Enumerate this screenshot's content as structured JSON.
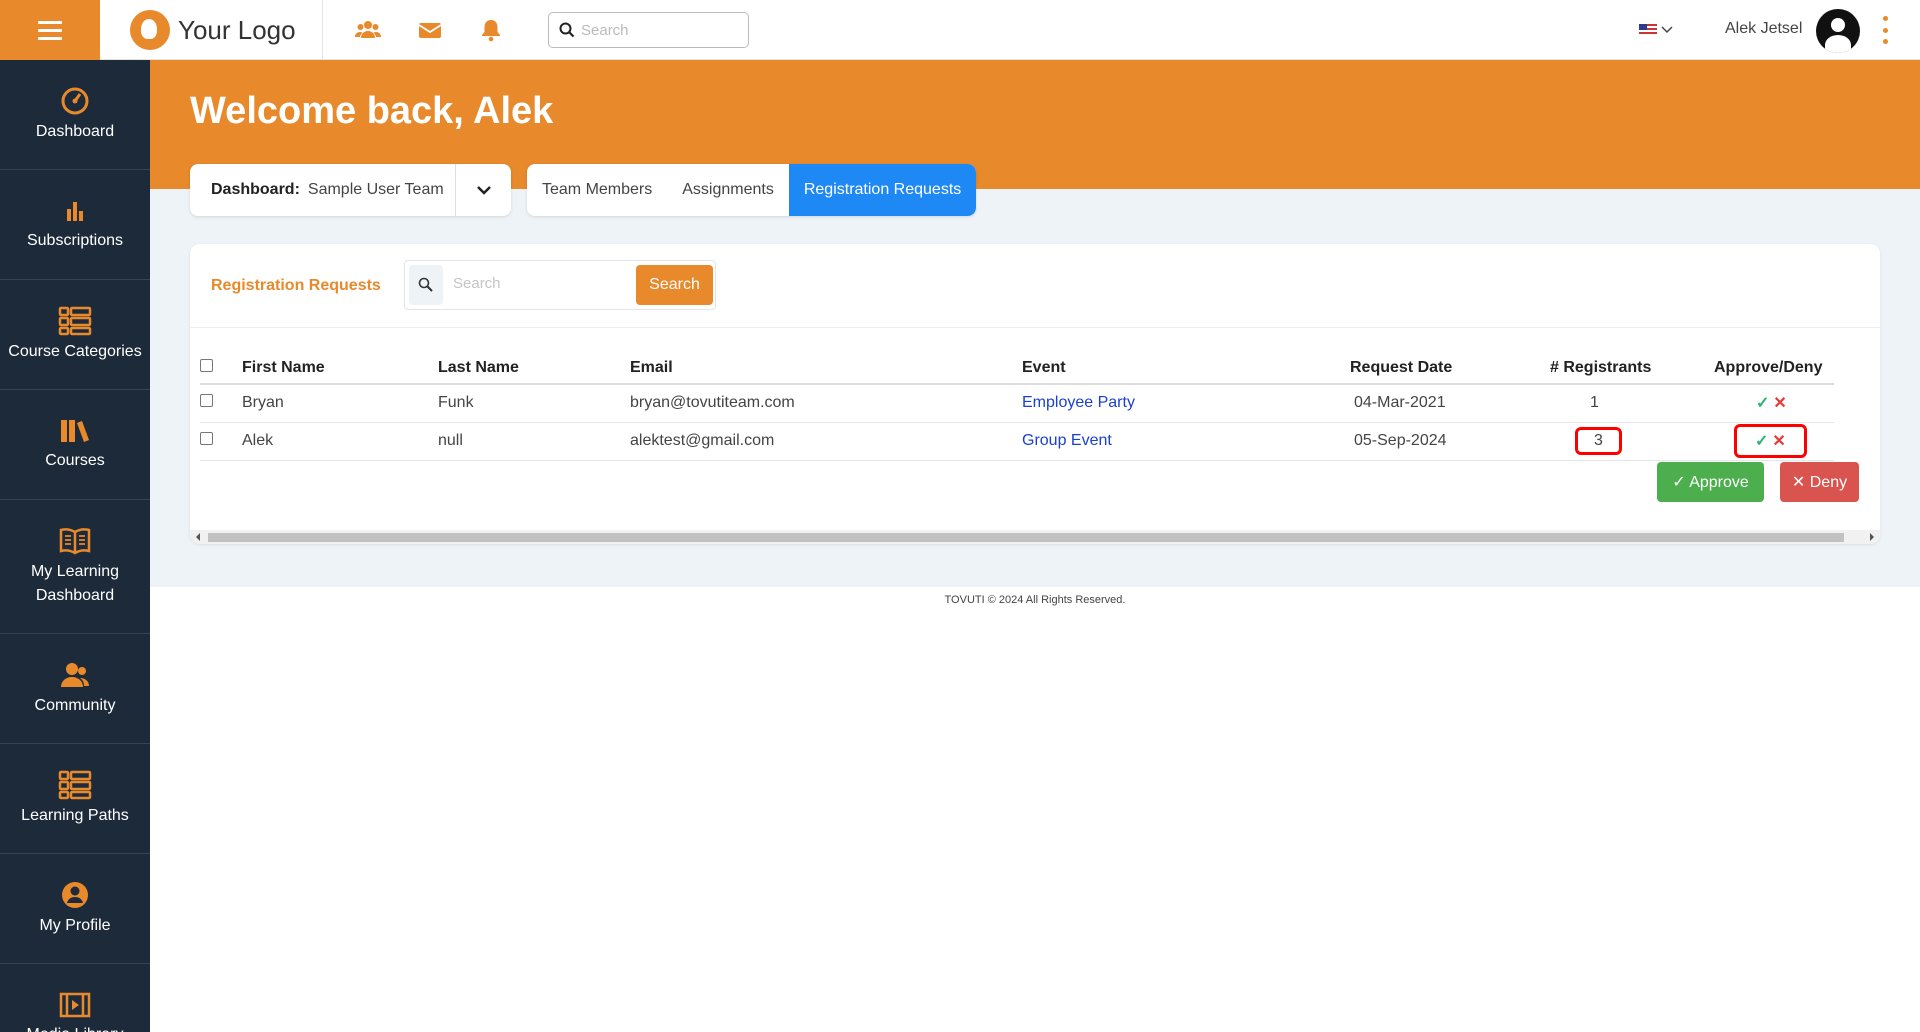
{
  "topbar": {
    "logo_text": "Your Logo",
    "search_placeholder": "Search",
    "username": "Alek Jetsel",
    "icons": [
      "menu-icon",
      "team-icon",
      "mail-icon",
      "bell-icon",
      "search-icon",
      "flag-icon",
      "chevron-down-icon",
      "avatar-icon",
      "kebab-icon"
    ]
  },
  "sidebar": {
    "items": [
      {
        "label": "Dashboard",
        "icon": "gauge-icon"
      },
      {
        "label": "Subscriptions",
        "icon": "bar-chart-icon"
      },
      {
        "label": "Course Categories",
        "icon": "list-icon"
      },
      {
        "label": "Courses",
        "icon": "books-icon"
      },
      {
        "label": "My Learning Dashboard",
        "icon": "open-book-icon"
      },
      {
        "label": "Community",
        "icon": "people-icon"
      },
      {
        "label": "Learning Paths",
        "icon": "list-icon"
      },
      {
        "label": "My Profile",
        "icon": "user-circle-icon"
      },
      {
        "label": "Media Library",
        "icon": "film-icon"
      }
    ]
  },
  "hero": {
    "title": "Welcome back, Alek"
  },
  "dashboard_select": {
    "label": "Dashboard:",
    "value": "Sample User Team"
  },
  "tabs": [
    {
      "label": "Team Members",
      "active": false
    },
    {
      "label": "Assignments",
      "active": false
    },
    {
      "label": "Registration Requests",
      "active": true
    }
  ],
  "panel": {
    "title": "Registration Requests",
    "search_placeholder": "Search",
    "search_button": "Search",
    "columns": [
      "First Name",
      "Last Name",
      "Email",
      "Event",
      "Request Date",
      "# Registrants",
      "Approve/Deny"
    ],
    "rows": [
      {
        "first": "Bryan",
        "last": "Funk",
        "email": "bryan@tovutiteam.com",
        "event": "Employee Party",
        "date": "04-Mar-2021",
        "registrants": "1"
      },
      {
        "first": "Alek",
        "last": "null",
        "email": "alektest@gmail.com",
        "event": "Group Event",
        "date": "05-Sep-2024",
        "registrants": "3"
      }
    ],
    "approve_symbol": "✓",
    "deny_symbol": "✕",
    "approve_button": "✓ Approve",
    "deny_button": "✕ Deny"
  },
  "footer": {
    "text": "TOVUTI © 2024 All Rights Reserved."
  },
  "colors": {
    "brand_orange": "#e8892c",
    "sidebar_bg": "#1d2a3a",
    "tab_active": "#1e88f5",
    "approve": "#4cae4c",
    "deny": "#d9534f",
    "highlight": "#ff0000"
  }
}
